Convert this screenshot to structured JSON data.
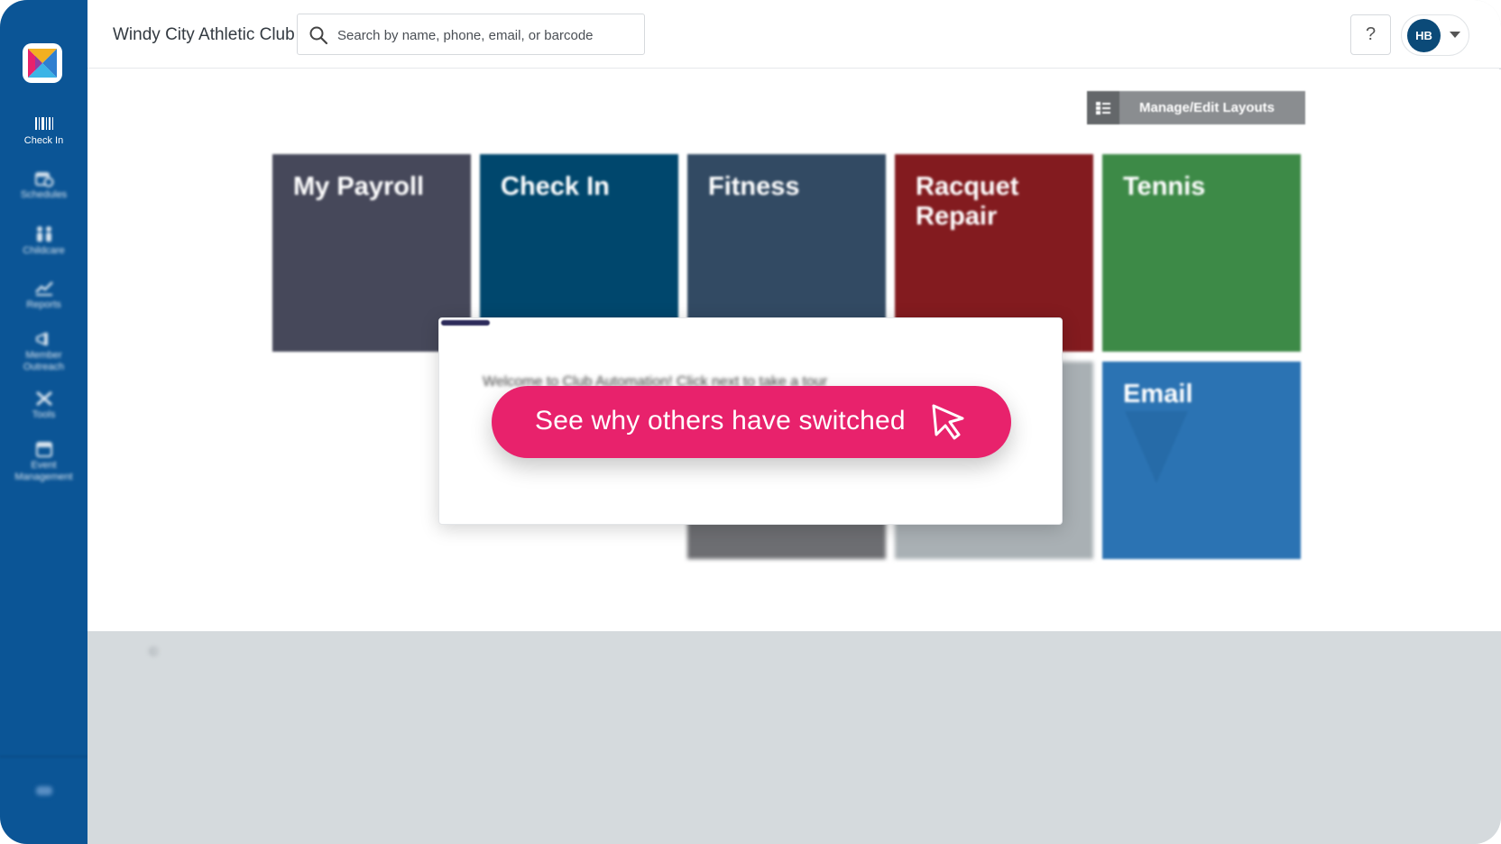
{
  "app": {
    "club_name": "Windy City Athletic Club"
  },
  "search": {
    "placeholder": "Search by name, phone, email, or barcode"
  },
  "header": {
    "help_label": "?",
    "user_initials": "HB"
  },
  "sidebar": {
    "items": [
      {
        "label": "Check In",
        "icon": "barcode-icon"
      },
      {
        "label": "Schedules",
        "icon": "calendar-clock-icon"
      },
      {
        "label": "Childcare",
        "icon": "family-icon"
      },
      {
        "label": "Reports",
        "icon": "chart-icon"
      },
      {
        "label": "Member Outreach",
        "icon": "megaphone-icon"
      },
      {
        "label": "Tools",
        "icon": "tools-icon"
      },
      {
        "label": "Event Management",
        "icon": "event-calendar-icon"
      }
    ]
  },
  "toolbar": {
    "manage_label": "Manage/Edit Layouts"
  },
  "tiles": [
    {
      "label": "My Payroll",
      "color": "#46485a"
    },
    {
      "label": "Check In",
      "color": "#00476d"
    },
    {
      "label": "Fitness",
      "color": "#324a63"
    },
    {
      "label": "Racquet Repair",
      "color": "#831b1f"
    },
    {
      "label": "Tennis",
      "color": "#3d8a47"
    },
    {
      "label": "Email",
      "color": "#2b73b3"
    }
  ],
  "popup": {
    "message": "Welcome to Club Automation! Click next to take a tour"
  },
  "cta": {
    "label": "See why others have switched",
    "color": "#e8226c"
  }
}
